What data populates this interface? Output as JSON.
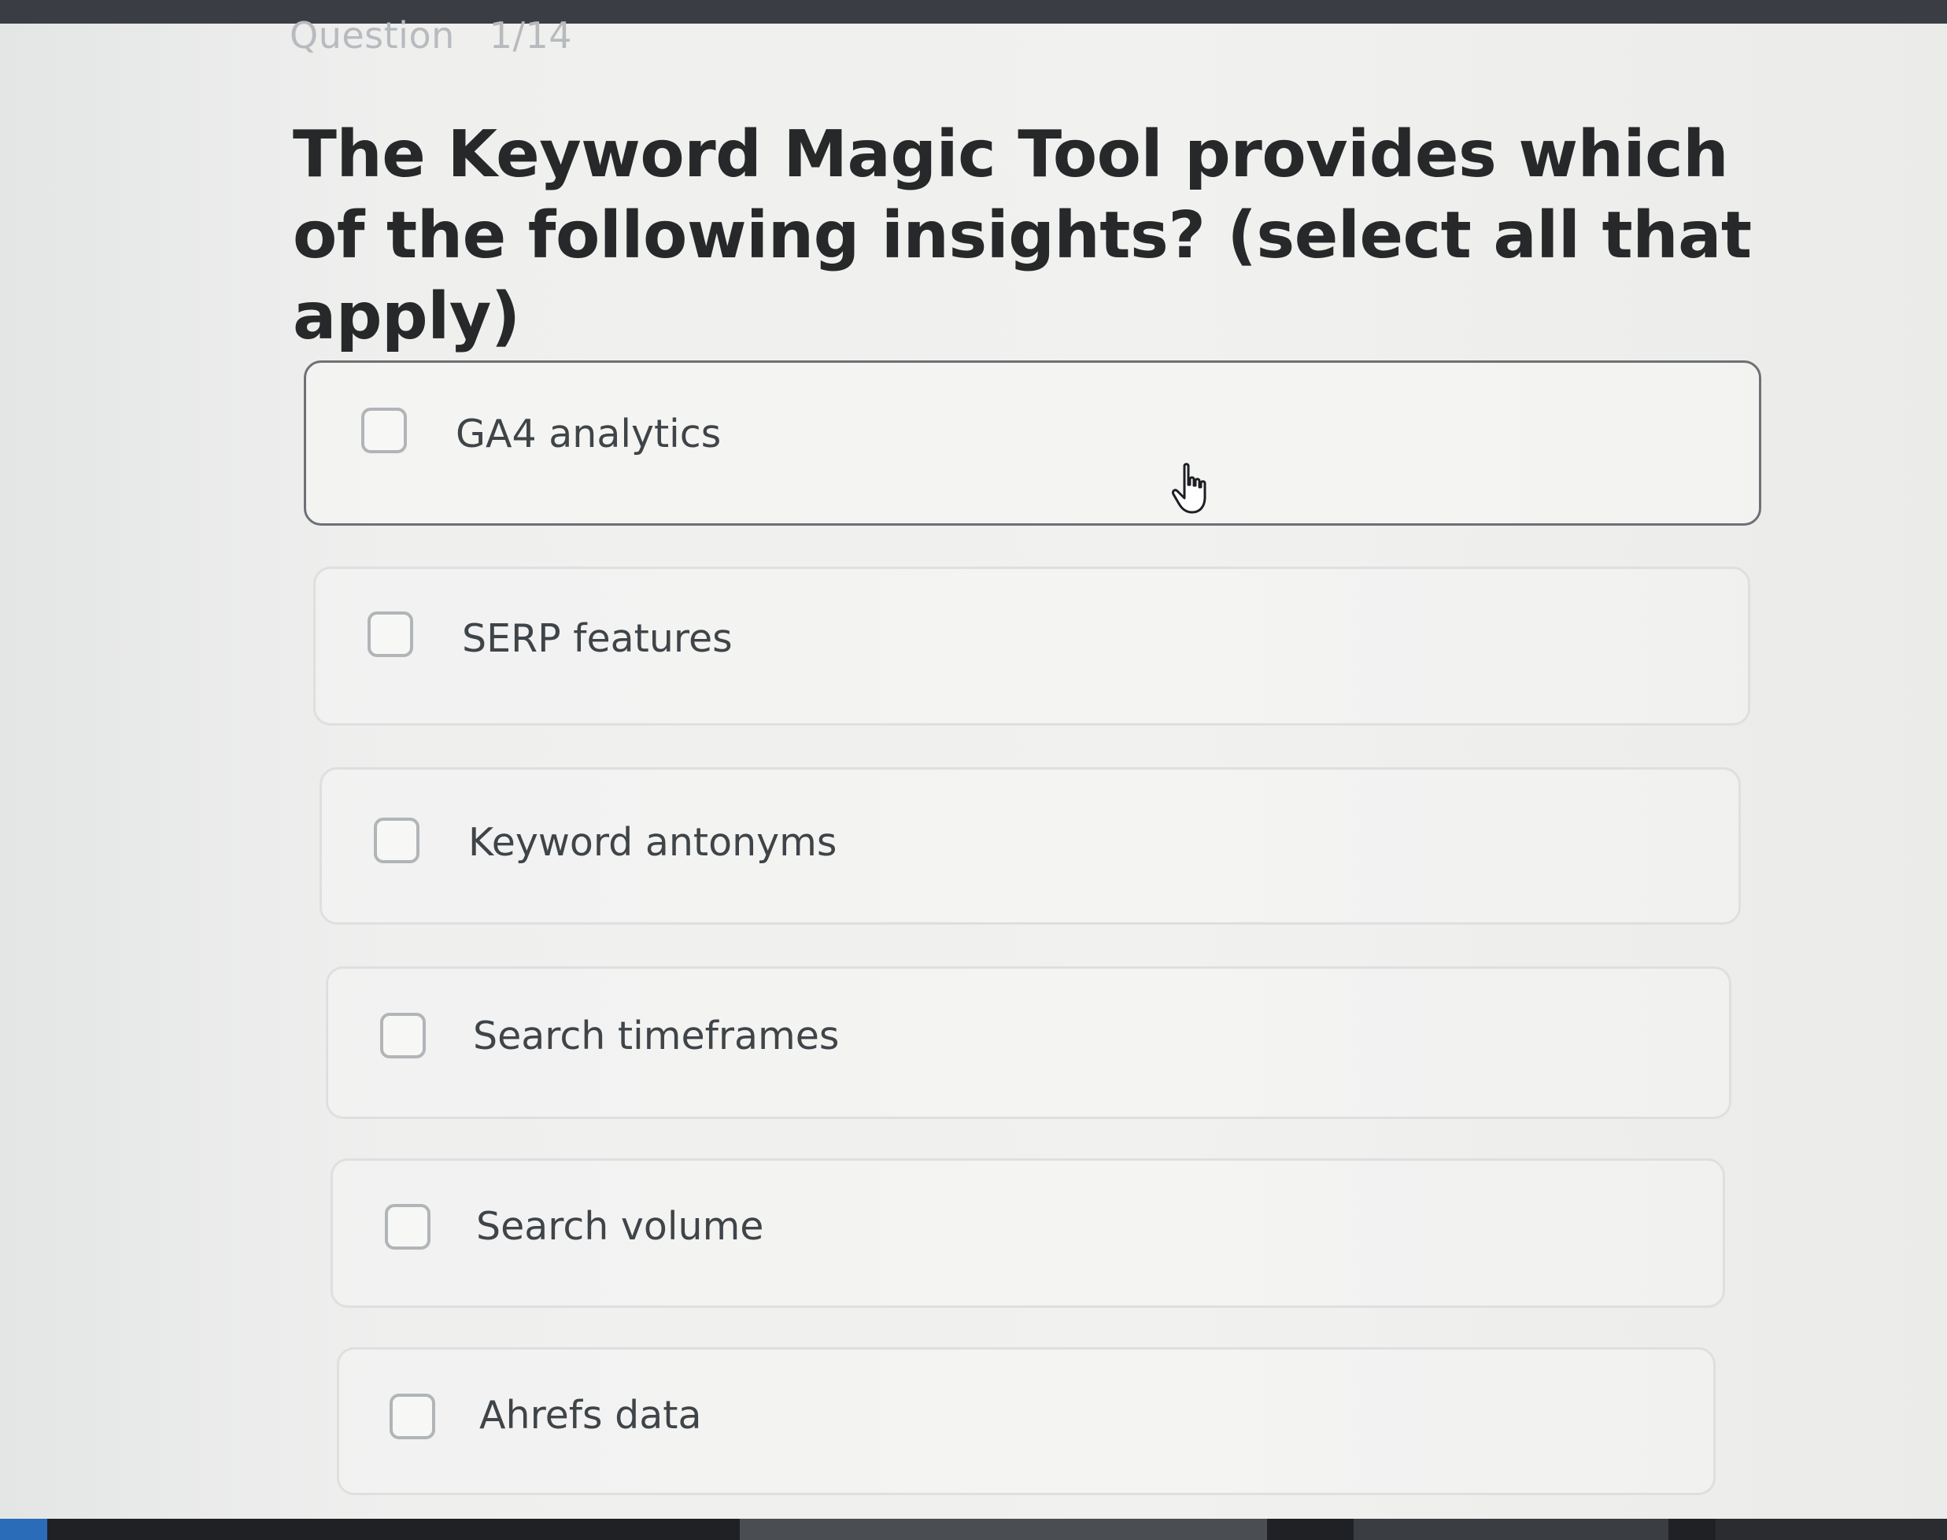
{
  "quiz": {
    "counter_label": "Question",
    "counter_value": "1/14",
    "question": "The Keyword Magic Tool provides which of the following insights? (select all that apply)",
    "options": [
      {
        "label": "GA4 analytics",
        "checked": false
      },
      {
        "label": "SERP features",
        "checked": false
      },
      {
        "label": "Keyword antonyms",
        "checked": false
      },
      {
        "label": "Search timeframes",
        "checked": false
      },
      {
        "label": "Search volume",
        "checked": false
      },
      {
        "label": "Ahrefs data",
        "checked": false
      }
    ]
  },
  "cursor": {
    "icon": "hand-pointer-icon"
  },
  "colors": {
    "title_text": "#27282a",
    "option_text": "#3f4448",
    "hover_border": "#6d7175",
    "option_border": "#dedfdf",
    "checkbox_border": "#b1b5b8"
  }
}
